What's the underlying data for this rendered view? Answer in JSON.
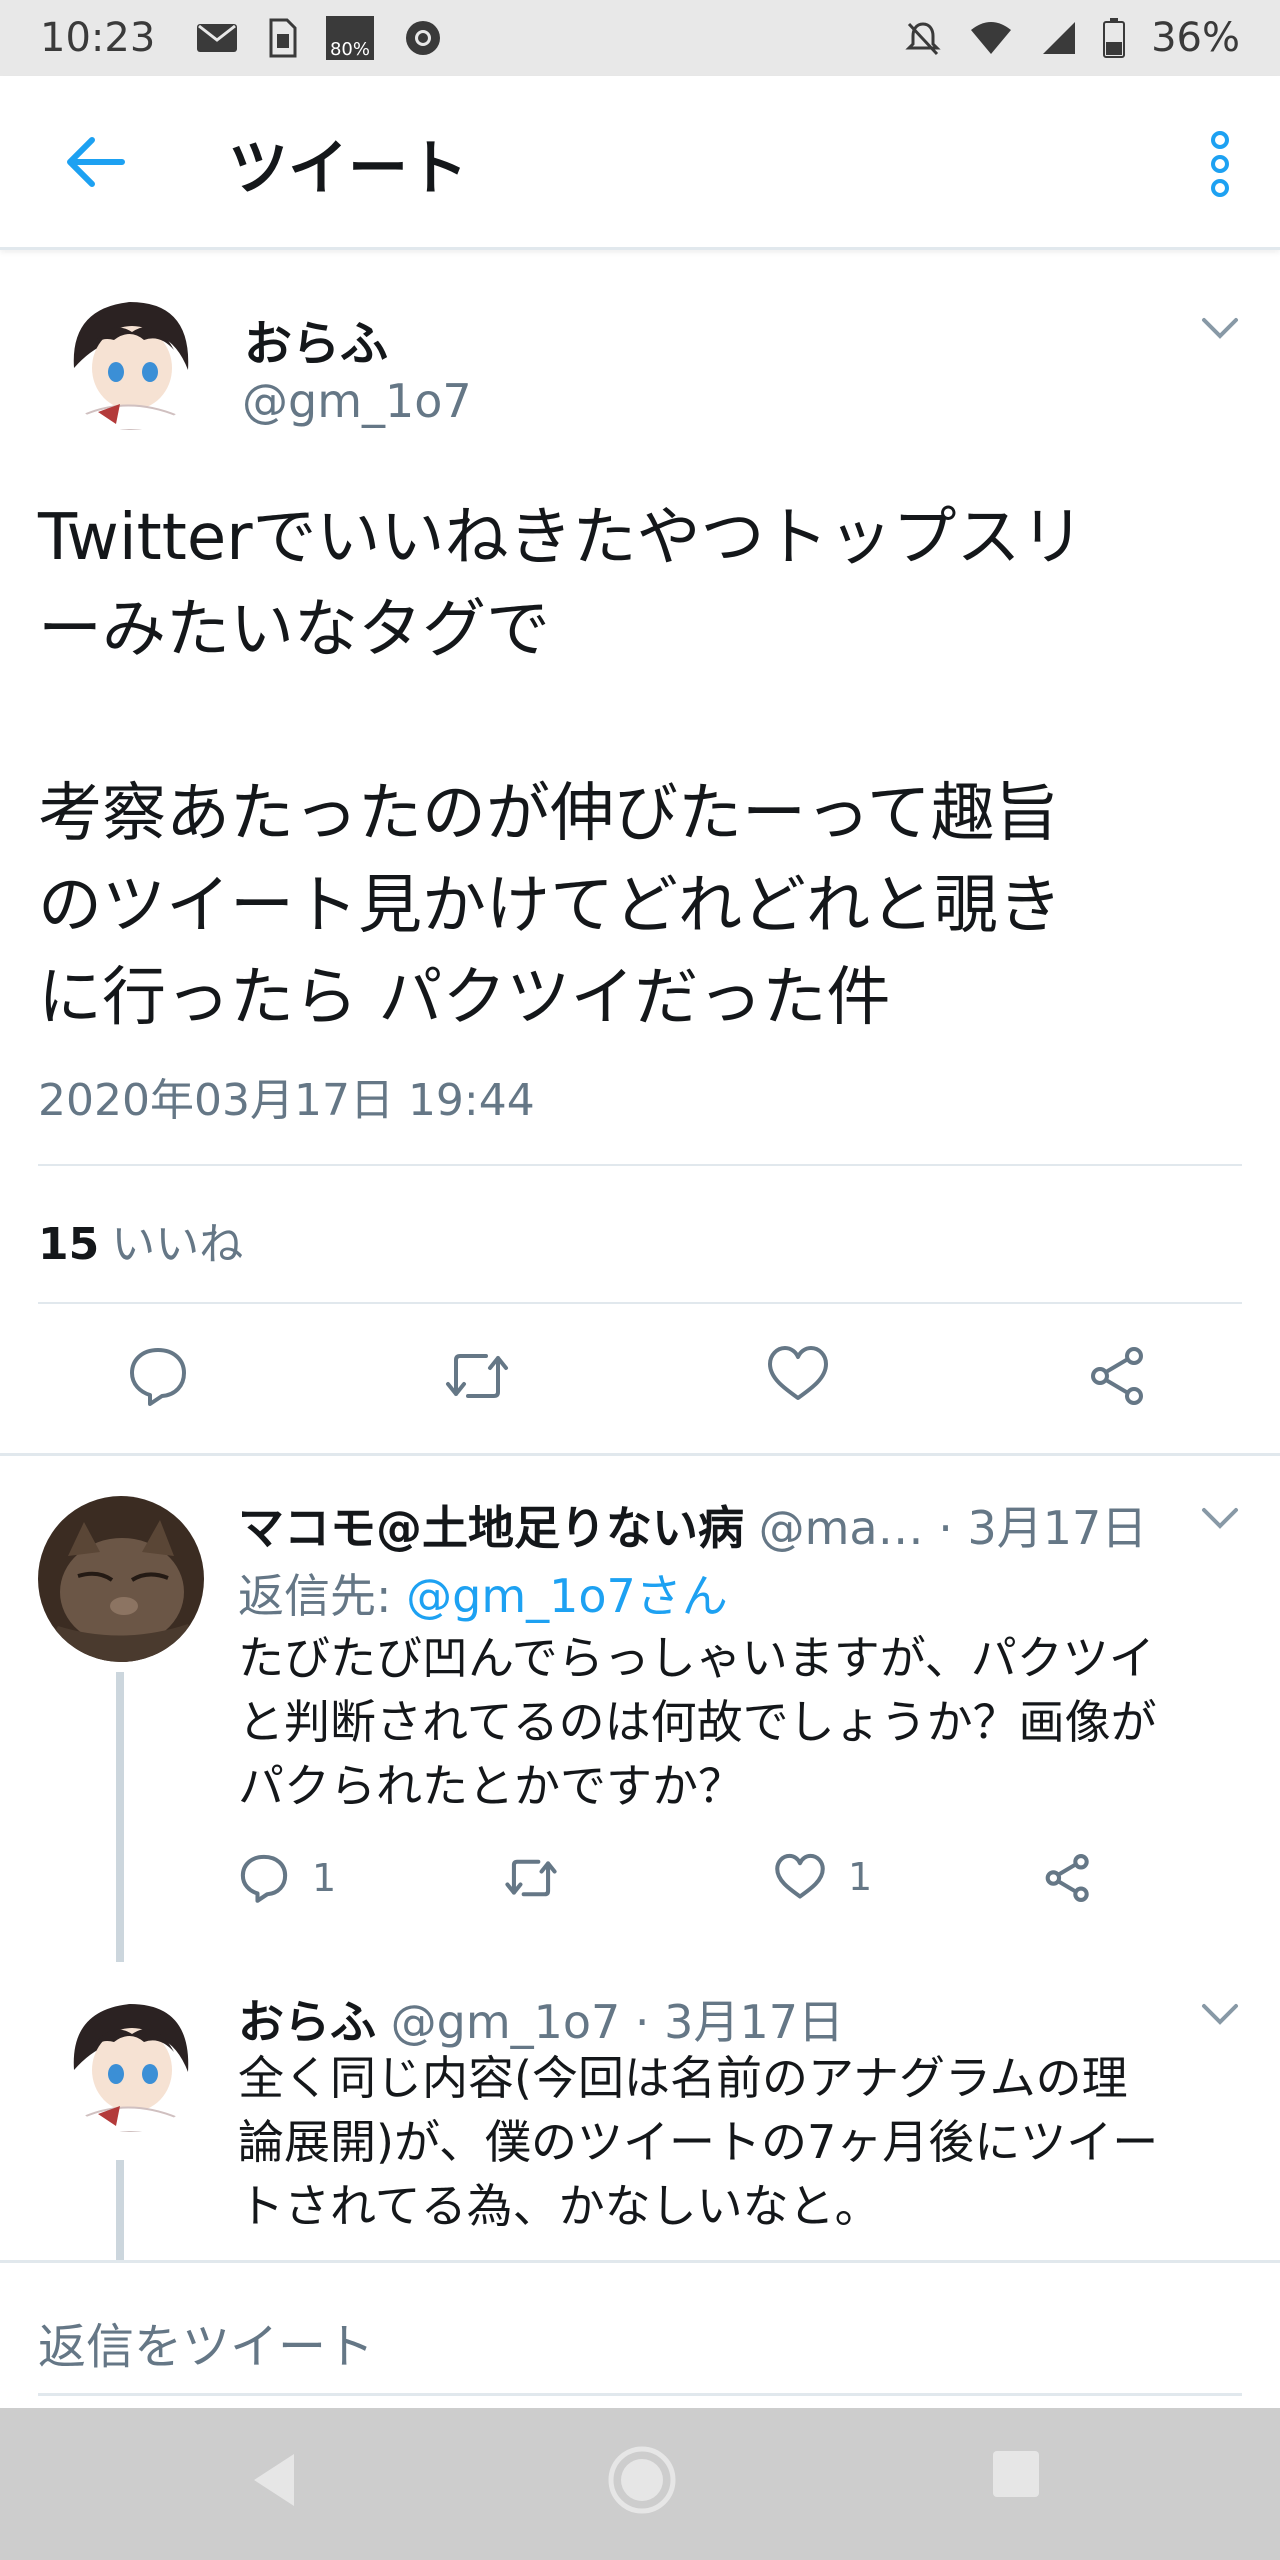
{
  "status_bar": {
    "time": "10:23",
    "badge_text": "80%",
    "battery": "36%"
  },
  "header": {
    "title": "ツイート"
  },
  "tweet": {
    "author_name": "おらふ",
    "author_handle": "@gm_1o7",
    "text": "Twitterでいいねきたやつトップスリ\nーみたいなタグで\n\n考察あたったのが伸びたーって趣旨\nのツイート見かけてどれどれと覗き\nに行ったら パクツイだった件",
    "timestamp": "2020年03月17日 19:44",
    "likes_count": "15",
    "likes_label": "いいね"
  },
  "replies": [
    {
      "name": "マコモ@土地足りない病",
      "meta": " @ma… · 3月17日",
      "reply_to_prefix": "返信先: ",
      "reply_to_link": "@gm_1o7さん",
      "text": "たびたび凹んでらっしゃいますが、パクツイ\nと判断されてるのは何故でしょうか？画像が\nパクられたとかですか？",
      "reply_count": "1",
      "like_count": "1"
    },
    {
      "name": "おらふ",
      "meta": " @gm_1o7 · 3月17日",
      "text": "全く同じ内容(今回は名前のアナグラムの理\n論展開)が、僕のツイートの7ヶ月後にツイー\nトされてる為、かなしいなと。"
    }
  ],
  "composer": {
    "placeholder": "返信をツイート"
  },
  "colors": {
    "accent": "#1da1f2",
    "secondary_text": "#657786",
    "primary_text": "#14171a",
    "divider": "#e1e8ed"
  },
  "icons": {
    "back": "arrow-left-icon",
    "overflow": "more-vertical-icon",
    "reply": "comment-icon",
    "retweet": "retweet-icon",
    "like": "heart-icon",
    "share": "share-icon"
  }
}
